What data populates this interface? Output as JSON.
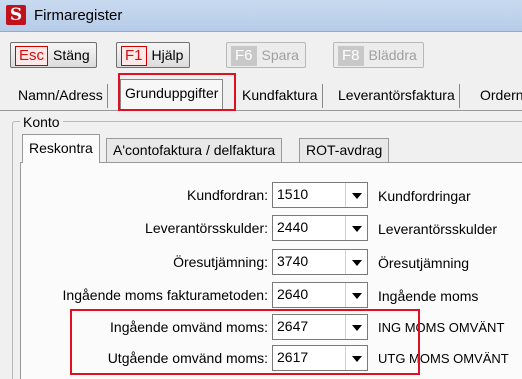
{
  "window": {
    "title": "Firmaregister",
    "icon_letter": "S"
  },
  "toolbar": {
    "buttons": [
      {
        "key": "Esc",
        "label": "Stäng",
        "enabled": true
      },
      {
        "key": "F1",
        "label": "Hjälp",
        "enabled": true
      },
      {
        "key": "F6",
        "label": "Spara",
        "enabled": false
      },
      {
        "key": "F8",
        "label": "Bläddra",
        "enabled": false
      }
    ]
  },
  "tabs": {
    "items": [
      "Namn/Adress",
      "Grunduppgifter",
      "Kundfaktura",
      "Leverantörsfaktura",
      "Ordern"
    ],
    "active": "Grunduppgifter"
  },
  "konto": {
    "group_label": "Konto",
    "tabs": [
      "Reskontra",
      "A'contofaktura / delfaktura",
      "ROT-avdrag"
    ],
    "active_tab": "Reskontra",
    "rows": [
      {
        "label": "Kundfordran:",
        "account": "1510",
        "description": "Kundfordringar"
      },
      {
        "label": "Leverantörsskulder:",
        "account": "2440",
        "description": "Leverantörsskulder"
      },
      {
        "label": "Öresutjämning:",
        "account": "3740",
        "description": "Öresutjämning"
      },
      {
        "label": "Ingående moms fakturametoden:",
        "account": "2640",
        "description": "Ingående moms"
      },
      {
        "label": "Ingående  omvänd moms:",
        "account": "2647",
        "description": "ING MOMS OMVÄNT"
      },
      {
        "label": "Utgående omvänd moms:",
        "account": "2617",
        "description": "UTG MOMS OMVÄNT"
      }
    ]
  },
  "colors": {
    "highlight": "#e01020",
    "key_red": "#d01010"
  }
}
